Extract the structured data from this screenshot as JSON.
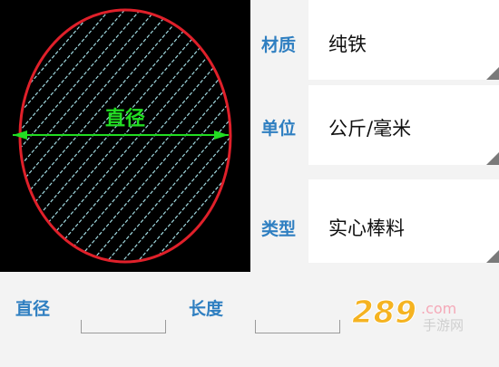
{
  "diagram": {
    "label": "直径",
    "colors": {
      "circle": "#e0202a",
      "hatch": "#9fd8df",
      "dimension": "#22dd22",
      "background": "#000000"
    }
  },
  "properties": [
    {
      "label": "材质",
      "value": "纯铁"
    },
    {
      "label": "单位",
      "value": "公斤/毫米"
    },
    {
      "label": "类型",
      "value": "实心棒料"
    }
  ],
  "inputs": {
    "diameter": {
      "label": "直径",
      "value": ""
    },
    "length": {
      "label": "长度",
      "value": ""
    }
  },
  "watermark": {
    "number": "289",
    "suffix": ".com",
    "text": "手游网"
  },
  "colors": {
    "accent": "#2f7fc1",
    "panel": "#ffffff",
    "page": "#f3f3f3"
  }
}
